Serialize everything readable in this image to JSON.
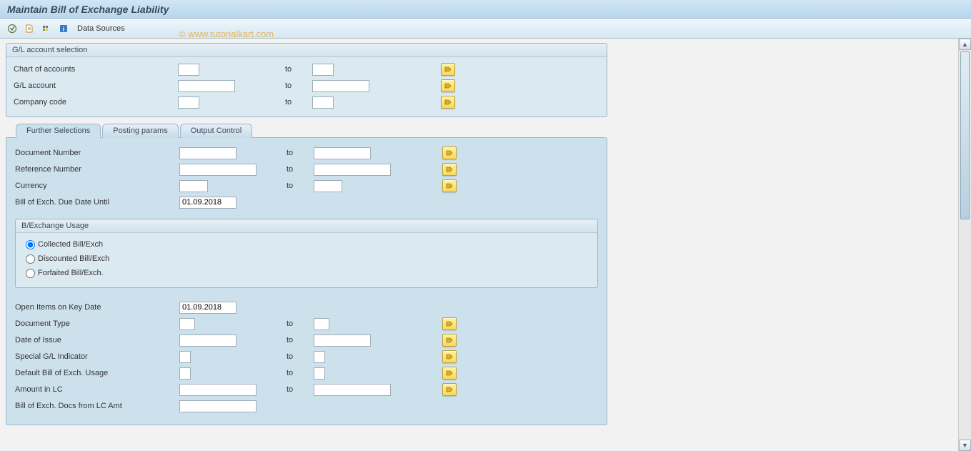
{
  "title": "Maintain Bill of Exchange Liability",
  "toolbar": {
    "data_sources": "Data Sources"
  },
  "watermark": "© www.tutorialkart.com",
  "gl_selection": {
    "title": "G/L account selection",
    "rows": {
      "chart": {
        "label": "Chart of accounts",
        "to": "to"
      },
      "account": {
        "label": "G/L account",
        "to": "to"
      },
      "company": {
        "label": "Company code",
        "to": "to"
      }
    }
  },
  "tabs": {
    "t1": "Further Selections",
    "t2": "Posting params",
    "t3": "Output Control"
  },
  "further": {
    "doc_num": {
      "label": "Document Number",
      "to": "to"
    },
    "ref_num": {
      "label": "Reference Number",
      "to": "to"
    },
    "currency": {
      "label": "Currency",
      "to": "to"
    },
    "due_until": {
      "label": "Bill of Exch. Due Date Until",
      "value": "01.09.2018"
    }
  },
  "usage_group": {
    "title": "B/Exchange Usage",
    "opt1": "Collected Bill/Exch",
    "opt2": "Discounted Bill/Exch",
    "opt3": "Forfaited Bill/Exch."
  },
  "lower": {
    "open_items": {
      "label": "Open Items on Key Date",
      "value": "01.09.2018"
    },
    "doc_type": {
      "label": "Document Type",
      "to": "to"
    },
    "issue_date": {
      "label": "Date of Issue",
      "to": "to"
    },
    "spec_gl": {
      "label": "Special G/L Indicator",
      "to": "to"
    },
    "def_usage": {
      "label": "Default Bill of Exch. Usage",
      "to": "to"
    },
    "amount_lc": {
      "label": "Amount in LC",
      "to": "to"
    },
    "docs_lc": {
      "label": "Bill of Exch. Docs from LC Amt"
    }
  }
}
